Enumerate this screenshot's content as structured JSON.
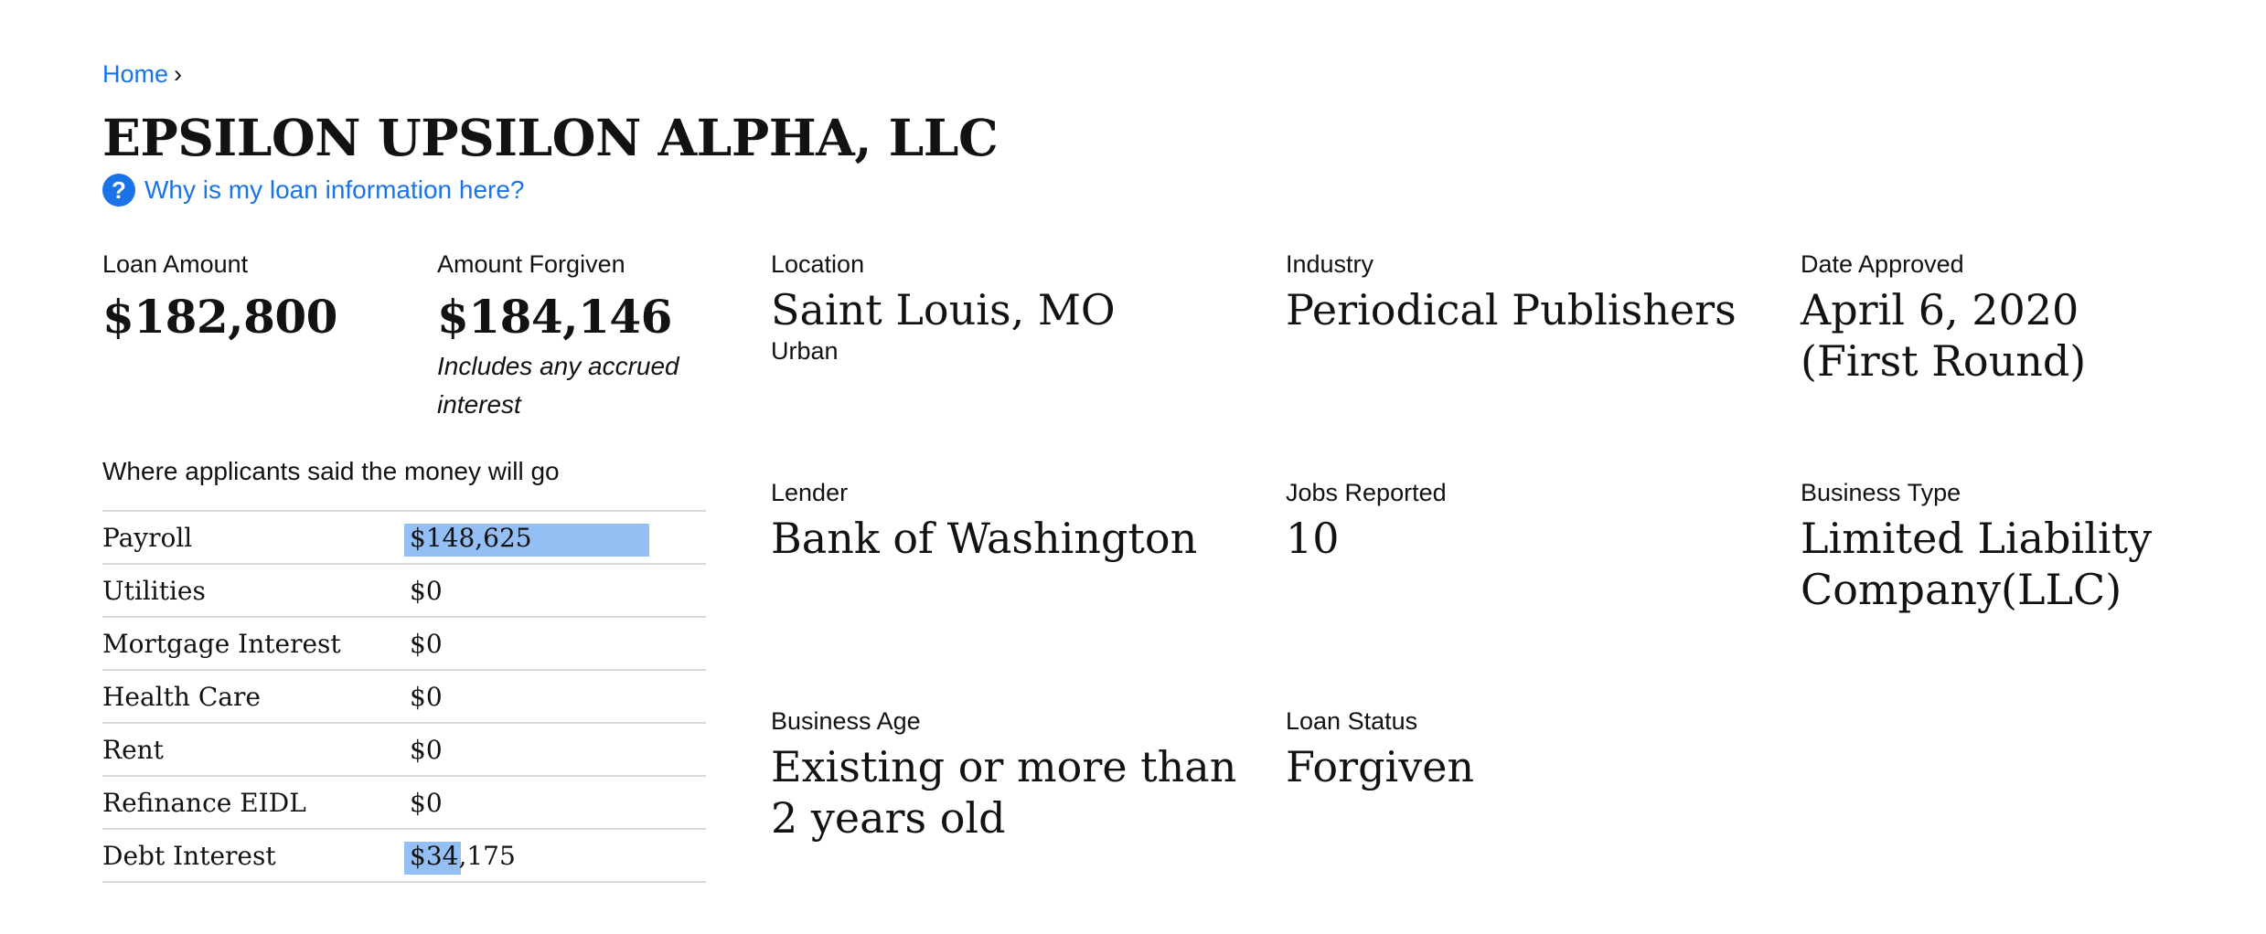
{
  "breadcrumb": {
    "home": "Home",
    "separator": "›"
  },
  "business_name": "EPSILON UPSILON ALPHA, LLC",
  "why_link": {
    "icon": "?",
    "text": "Why is my loan information here?"
  },
  "loan_amount": {
    "label": "Loan Amount",
    "value": "$182,800"
  },
  "amount_forgiven": {
    "label": "Amount Forgiven",
    "value": "$184,146",
    "note": "Includes any accrued interest"
  },
  "fields": {
    "location": {
      "label": "Location",
      "value": "Saint Louis, MO",
      "sub": "Urban"
    },
    "industry": {
      "label": "Industry",
      "value": "Periodical Publishers"
    },
    "date_approved": {
      "label": "Date Approved",
      "value": "April 6, 2020 (First Round)"
    },
    "lender": {
      "label": "Lender",
      "value": "Bank of Washington"
    },
    "jobs_reported": {
      "label": "Jobs Reported",
      "value": "10"
    },
    "business_type": {
      "label": "Business Type",
      "value": "Limited Liability Company(LLC)"
    },
    "business_age": {
      "label": "Business Age",
      "value": "Existing or more than 2 years old"
    },
    "loan_status": {
      "label": "Loan Status",
      "value": "Forgiven"
    }
  },
  "breakdown": {
    "title": "Where applicants said the money will go",
    "rows": [
      {
        "name": "Payroll",
        "amount": "$148,625",
        "fraction": 0.813
      },
      {
        "name": "Utilities",
        "amount": "$0",
        "fraction": 0
      },
      {
        "name": "Mortgage Interest",
        "amount": "$0",
        "fraction": 0
      },
      {
        "name": "Health Care",
        "amount": "$0",
        "fraction": 0
      },
      {
        "name": "Rent",
        "amount": "$0",
        "fraction": 0
      },
      {
        "name": "Refinance EIDL",
        "amount": "$0",
        "fraction": 0
      },
      {
        "name": "Debt Interest",
        "amount": "$34,175",
        "fraction": 0.187
      }
    ]
  },
  "colors": {
    "link": "#1a73e8",
    "bar": "#94bff5",
    "divider": "#d9d9d9",
    "text": "#121212"
  }
}
